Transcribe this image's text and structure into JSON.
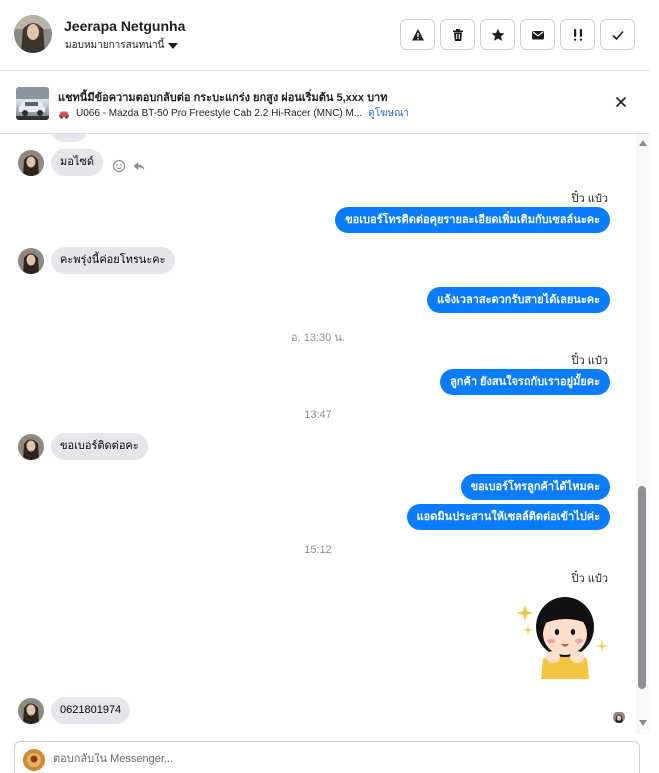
{
  "header": {
    "contact_name": "Jeerapa Netgunha",
    "assign_label": "มอบหมายการสนทนานี้",
    "actions": [
      {
        "icon": "warning-icon"
      },
      {
        "icon": "trash-icon"
      },
      {
        "icon": "star-icon"
      },
      {
        "icon": "envelope-icon"
      },
      {
        "icon": "priority-icon"
      },
      {
        "icon": "check-icon"
      }
    ]
  },
  "ad": {
    "title": "แชทนี้มีข้อความตอบกลับต่อ กระบะแกร่ง ยกสูง ผ่อนเริ่มต้น 5,xxx บาท",
    "subtitle": "U066 - Mazda BT-50 Pro Freestyle Cab 2.2 Hi-Racer (MNC) M...",
    "link": "ดูโฆษณา",
    "thumb_text": "U066"
  },
  "messages": {
    "m1": "มอไซด์",
    "sender_1": "ปิ๋ว แป๋ว",
    "m2": "ขอเบอร์โทรติดต่อคุยรายละเอียดเพิ่มเติมกับเซลล์นะคะ",
    "m3": "คะพรุ่งนี้ค่อยโทรนะคะ",
    "m4": "แจ้งเวลาสะดวกรับสายได้เลยนะคะ",
    "ts1": "อ. 13:30 น.",
    "sender_2": "ปิ๋ว แป๋ว",
    "m5": "ลูกค้า ยังสนใจรถกับเราอยู่มั้ยคะ",
    "ts2": "13:47",
    "m6": "ขอเบอร์ติดต่อคะ",
    "m7": "ขอเบอร์โทรลูกค้าได้ไหมคะ",
    "m8": "แอดมินประสานให้เซลล์ติดต่อเข้าไปค่ะ",
    "ts3": "15:12",
    "sender_3": "ปิ๋ว แป๋ว",
    "m9": "0621801974"
  },
  "composer": {
    "placeholder": "ตอบกลับใน Messenger..."
  },
  "colors": {
    "outgoing_bubble": "#0a7cff",
    "incoming_bubble": "#e4e6eb",
    "link": "#216fdb"
  }
}
